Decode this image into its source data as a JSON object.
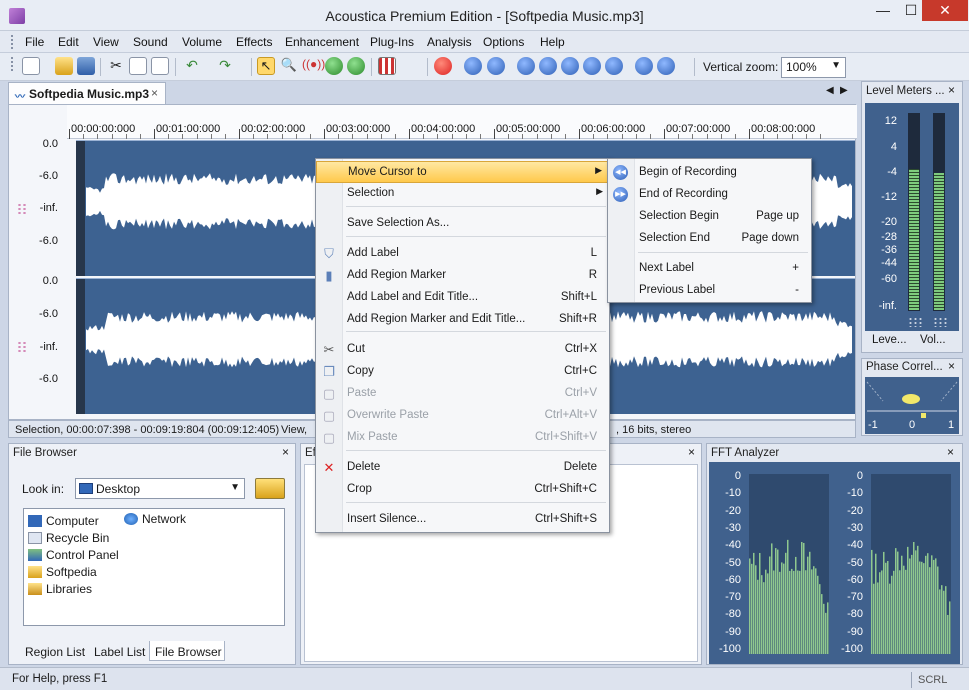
{
  "window": {
    "title": "Acoustica Premium Edition - [Softpedia Music.mp3]",
    "min_glyph": "—",
    "max_glyph": "☐",
    "close_glyph": "✕"
  },
  "menu": [
    "File",
    "Edit",
    "View",
    "Sound",
    "Volume",
    "Effects",
    "Enhancement",
    "Plug-Ins",
    "Analysis",
    "Options",
    "Help"
  ],
  "toolbar": {
    "vertical_zoom_label": "Vertical zoom:",
    "vertical_zoom_value": "100%"
  },
  "document": {
    "tab_label": "Softpedia Music.mp3",
    "tab_close": "×"
  },
  "ruler_ticks": [
    "00:00:00:000",
    "00:01:00:000",
    "00:02:00:000",
    "00:03:00:000",
    "00:04:00:000",
    "00:05:00:000",
    "00:06:00:000",
    "00:07:00:000",
    "00:08:00:000"
  ],
  "db_labels": [
    "0.0",
    "-6.0",
    "-inf.",
    "-6.0",
    "0.0",
    "-6.0",
    "-inf.",
    "-6.0"
  ],
  "selection_status": {
    "selection": "Selection, 00:00:07:398 - 00:09:19:804 (00:09:12:405)",
    "view": "View,",
    "format": ", 16 bits, stereo"
  },
  "level_meters": {
    "title": "Level Meters ...",
    "labels": [
      "12",
      "4",
      "-4",
      "-12",
      "-20",
      "-28",
      "-36",
      "-44",
      "-60",
      "-inf."
    ],
    "left_level": 0.72,
    "right_level": 0.7,
    "tab_left": "Leve...",
    "tab_right": "Vol..."
  },
  "phase": {
    "title": "Phase Correl...",
    "labels": [
      "-1",
      "0",
      "1"
    ]
  },
  "file_browser": {
    "title": "File Browser",
    "look_in_label": "Look in:",
    "look_in_value": "Desktop",
    "items": [
      "Computer",
      "Network",
      "Recycle Bin",
      "Control Panel",
      "Softpedia",
      "Libraries"
    ],
    "tabs": [
      "Region List",
      "Label List",
      "File Browser"
    ]
  },
  "effects_panel": {
    "title": "Ef"
  },
  "fft": {
    "title": "FFT Analyzer",
    "labels": [
      "0",
      "-10",
      "-20",
      "-30",
      "-40",
      "-50",
      "-60",
      "-70",
      "-80",
      "-90",
      "-100"
    ]
  },
  "statusbar": {
    "help": "For Help, press F1",
    "scrl": "SCRL"
  },
  "context_menu": {
    "items": [
      {
        "label": "Move Cursor to",
        "key": "",
        "state": "highlighted",
        "submenu": true
      },
      {
        "label": "Selection",
        "key": "",
        "state": "normal",
        "submenu": true
      },
      {
        "label": "Save Selection As...",
        "key": "",
        "state": "normal"
      },
      {
        "label": "Add Label",
        "key": "L",
        "state": "normal"
      },
      {
        "label": "Add Region Marker",
        "key": "R",
        "state": "normal"
      },
      {
        "label": "Add Label and Edit Title...",
        "key": "Shift+L",
        "state": "normal"
      },
      {
        "label": "Add Region Marker and Edit Title...",
        "key": "Shift+R",
        "state": "normal"
      },
      {
        "label": "Cut",
        "key": "Ctrl+X",
        "state": "normal"
      },
      {
        "label": "Copy",
        "key": "Ctrl+C",
        "state": "normal"
      },
      {
        "label": "Paste",
        "key": "Ctrl+V",
        "state": "disabled"
      },
      {
        "label": "Overwrite Paste",
        "key": "Ctrl+Alt+V",
        "state": "disabled"
      },
      {
        "label": "Mix Paste",
        "key": "Ctrl+Shift+V",
        "state": "disabled"
      },
      {
        "label": "Delete",
        "key": "Delete",
        "state": "normal"
      },
      {
        "label": "Crop",
        "key": "Ctrl+Shift+C",
        "state": "normal"
      },
      {
        "label": "Insert Silence...",
        "key": "Ctrl+Shift+S",
        "state": "normal"
      }
    ]
  },
  "submenu": {
    "items": [
      {
        "label": "Begin of Recording",
        "key": ""
      },
      {
        "label": "End of Recording",
        "key": ""
      },
      {
        "label": "Selection Begin",
        "key": "Page up"
      },
      {
        "label": "Selection End",
        "key": "Page down"
      },
      {
        "label": "Next Label",
        "key": "+"
      },
      {
        "label": "Previous Label",
        "key": "-"
      }
    ]
  },
  "colors": {
    "waveform_bg": "#3d6291",
    "waveform_fg": "#ffffff",
    "meter_green": "#7ecb7e",
    "menu_highlight": "#ffc94c",
    "close_red": "#c7392b"
  }
}
